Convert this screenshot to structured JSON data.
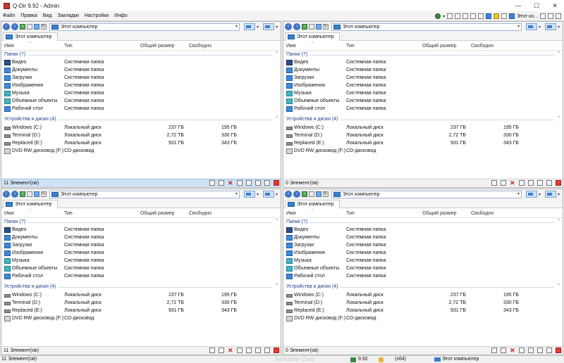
{
  "window": {
    "title": "Q-Dir 9.92 - Admin",
    "minimize": "—",
    "maximize": "☐",
    "close": "✕"
  },
  "menu": {
    "items": [
      "Файл",
      "Правка",
      "Вид",
      "Закладки",
      "Настройки",
      "Инфо"
    ],
    "tools_label": "Этот ко..."
  },
  "columns": {
    "name": "Имя",
    "type": "Тип",
    "total": "Общий размер",
    "free": "Свободно"
  },
  "groups": {
    "folders": "Папки (7)",
    "drives": "Устройства и диски (4)"
  },
  "folders": [
    {
      "name": "Видео",
      "type": "Системная папка",
      "icon": "video-folder-icon"
    },
    {
      "name": "Документы",
      "type": "Системная папка",
      "icon": "documents-folder-icon"
    },
    {
      "name": "Загрузки",
      "type": "Системная папка",
      "icon": "downloads-folder-icon"
    },
    {
      "name": "Изображения",
      "type": "Системная папка",
      "icon": "pictures-folder-icon"
    },
    {
      "name": "Музыка",
      "type": "Системная папка",
      "icon": "music-folder-icon"
    },
    {
      "name": "Объемные объекты",
      "type": "Системная папка",
      "icon": "3d-objects-folder-icon"
    },
    {
      "name": "Рабочий стол",
      "type": "Системная папка",
      "icon": "desktop-folder-icon"
    }
  ],
  "drives": [
    {
      "name": "Windows (C:)",
      "type": "Локальный диск",
      "total": "237 ГБ",
      "free": "195 ГБ"
    },
    {
      "name": "Terminal (D:)",
      "type": "Локальный диск",
      "total": "2,72 ТБ",
      "free": "330 ГБ"
    },
    {
      "name": "Replaced (E:)",
      "type": "Локальный диск",
      "total": "931 ГБ",
      "free": "343 ГБ"
    },
    {
      "name": "DVD RW дисковод (F:)",
      "type": "CD-дисковод",
      "total": "",
      "free": ""
    }
  ],
  "panes": [
    {
      "address": "Этот компьютер",
      "tab": "Этот компьютер",
      "status": "11 Элемент(ов)"
    },
    {
      "address": "Этот компьютер",
      "tab": "Этот компьютер",
      "status": "0 Элемент(ов)"
    },
    {
      "address": "Этот компьютер",
      "tab": "Этот компьютер",
      "status": "11 Элемент(ов)"
    },
    {
      "address": "Этот компьютер",
      "tab": "Этот компьютер",
      "status": "0 Элемент(ов)"
    }
  ],
  "statusbar": {
    "left": "11 Элемент(ов)",
    "brand": "NoNaMe-Club",
    "version": "9.92",
    "bits": "(x64)",
    "location": "Этот компьютер"
  },
  "colors": {
    "accent": "#3b7dd8",
    "active_status": "#cfe2f6",
    "group_text": "#1e3f8a",
    "delete": "#d21414"
  }
}
